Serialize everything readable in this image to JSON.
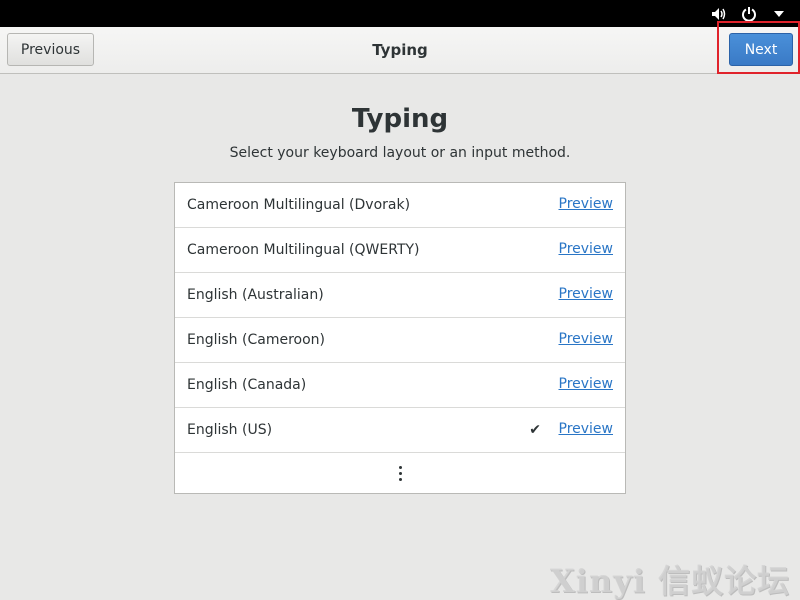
{
  "system_bar": {
    "icons": [
      "volume-icon",
      "power-icon",
      "menu-arrow-icon"
    ]
  },
  "header": {
    "title": "Typing",
    "previous_label": "Previous",
    "next_label": "Next"
  },
  "main": {
    "title": "Typing",
    "subtitle": "Select your keyboard layout or an input method.",
    "layouts": [
      {
        "label": "Cameroon Multilingual (Dvorak)",
        "preview": "Preview",
        "selected": false
      },
      {
        "label": "Cameroon Multilingual (QWERTY)",
        "preview": "Preview",
        "selected": false
      },
      {
        "label": "English (Australian)",
        "preview": "Preview",
        "selected": false
      },
      {
        "label": "English (Cameroon)",
        "preview": "Preview",
        "selected": false
      },
      {
        "label": "English (Canada)",
        "preview": "Preview",
        "selected": false
      },
      {
        "label": "English (US)",
        "preview": "Preview",
        "selected": true
      }
    ],
    "check_glyph": "✔",
    "more_icon": "vertical-ellipsis-icon"
  },
  "watermark": "Xinyi 信蚁论坛",
  "colors": {
    "accent": "#3a7ac6",
    "link": "#2a76c6",
    "highlight": "#e0232b"
  }
}
